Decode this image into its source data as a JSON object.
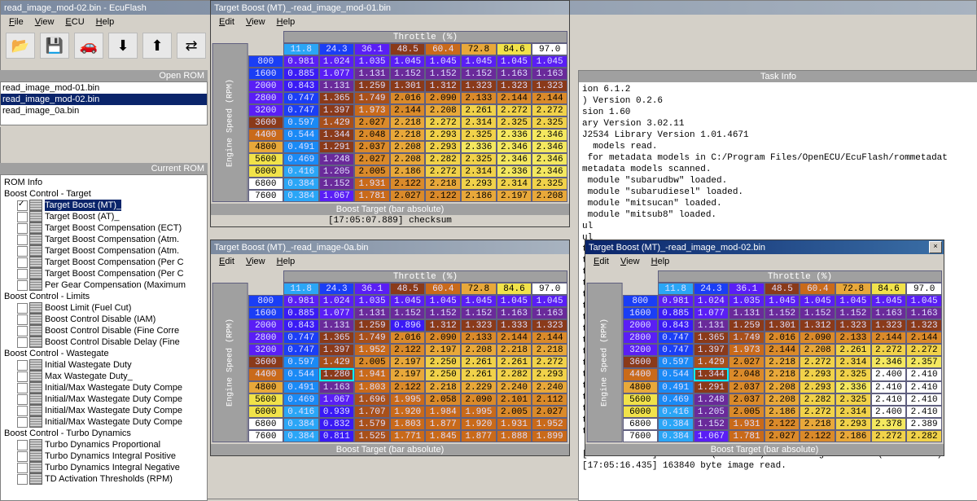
{
  "main": {
    "title": "read_image_mod-02.bin - EcuFlash",
    "menus": [
      "File",
      "View",
      "ECU",
      "Help"
    ],
    "toolbar_icons": [
      "folder-open-icon",
      "save-icon",
      "car-icon",
      "chip-read-icon",
      "chip-write-icon",
      "chip-compare-icon",
      "chip-test-icon"
    ]
  },
  "openrom": {
    "title": "Open ROM",
    "files": [
      "read_image_mod-01.bin",
      "read_image_mod-02.bin",
      "read_image_0a.bin"
    ],
    "selected": 1
  },
  "currentrom": {
    "title": "Current ROM",
    "groups": [
      {
        "label": "ROM Info",
        "depth": 0
      },
      {
        "label": "Boost Control - Target",
        "depth": 0
      },
      {
        "label": "Target Boost (MT)_",
        "depth": 1,
        "checked": true,
        "icon": true,
        "selected": true
      },
      {
        "label": "Target Boost (AT)_",
        "depth": 1,
        "icon": true
      },
      {
        "label": "Target Boost Compensation (ECT)",
        "depth": 1,
        "icon": true
      },
      {
        "label": "Target Boost Compensation (Atm.",
        "depth": 1,
        "icon": true
      },
      {
        "label": "Target Boost Compensation (Atm.",
        "depth": 1,
        "icon": true
      },
      {
        "label": "Target Boost Compensation (Per C",
        "depth": 1,
        "icon": true
      },
      {
        "label": "Target Boost Compensation (Per C",
        "depth": 1,
        "icon": true
      },
      {
        "label": "Per Gear Compensation (Maximum",
        "depth": 1,
        "icon": true
      },
      {
        "label": "Boost Control - Limits",
        "depth": 0
      },
      {
        "label": "Boost Limit (Fuel Cut)",
        "depth": 1,
        "icon": true
      },
      {
        "label": "Boost Control Disable (IAM)",
        "depth": 1,
        "icon": true
      },
      {
        "label": "Boost Control Disable (Fine Corre",
        "depth": 1,
        "icon": true
      },
      {
        "label": "Boost Control Disable Delay (Fine",
        "depth": 1,
        "icon": true
      },
      {
        "label": "Boost Control - Wastegate",
        "depth": 0
      },
      {
        "label": "Initial Wastegate Duty",
        "depth": 1,
        "icon": true
      },
      {
        "label": "Max Wastegate Duty_",
        "depth": 1,
        "icon": true
      },
      {
        "label": "Initial/Max Wastegate Duty Compe",
        "depth": 1,
        "icon": true
      },
      {
        "label": "Initial/Max Wastegate Duty Compe",
        "depth": 1,
        "icon": true
      },
      {
        "label": "Initial/Max Wastegate Duty Compe",
        "depth": 1,
        "icon": true
      },
      {
        "label": "Initial/Max Wastegate Duty Compe",
        "depth": 1,
        "icon": true
      },
      {
        "label": "Boost Control - Turbo Dynamics",
        "depth": 0
      },
      {
        "label": "Turbo Dynamics Proportional",
        "depth": 1,
        "icon": true
      },
      {
        "label": "Turbo Dynamics Integral Positive",
        "depth": 1,
        "icon": true
      },
      {
        "label": "Turbo Dynamics Integral Negative",
        "depth": 1,
        "icon": true
      },
      {
        "label": "TD Activation Thresholds (RPM)",
        "depth": 1,
        "icon": true
      }
    ]
  },
  "throttle_header": "Throttle (%)",
  "engine_speed_label": "Engine Speed (RPM)",
  "footer_label": "Boost Target (bar absolute)",
  "throttle": [
    "11.8",
    "24.3",
    "36.1",
    "48.5",
    "60.4",
    "72.8",
    "84.6",
    "97.0"
  ],
  "rpm": [
    "800",
    "1600",
    "2000",
    "2800",
    "3200",
    "3600",
    "4400",
    "4800",
    "5600",
    "6000",
    "6800",
    "7600"
  ],
  "throttle_colors": [
    "#2aa6f6",
    "#1a3ef5",
    "#5a1ef5",
    "#8a3a1a",
    "#c96a1a",
    "#e8a83a",
    "#f1e24a",
    "#ffffff"
  ],
  "rpm_colors": [
    "#1a3ef5",
    "#1a3ef5",
    "#5a1ef5",
    "#5a1ef5",
    "#5a1ef5",
    "#8a3a1a",
    "#c96a1a",
    "#e8a83a",
    "#f1e24a",
    "#f1e24a",
    "#ffffff",
    "#ffffff"
  ],
  "tables": {
    "mod01": {
      "title": "Target Boost (MT)_-read_image_mod-01.bin",
      "menus": [
        "Edit",
        "View",
        "Help"
      ],
      "log": "[17:05:07.889] checksum",
      "hilight_cell": null,
      "data": [
        [
          "0.981",
          "1.024",
          "1.035",
          "1.045",
          "1.045",
          "1.045",
          "1.045",
          "1.045"
        ],
        [
          "0.885",
          "1.077",
          "1.131",
          "1.152",
          "1.152",
          "1.152",
          "1.163",
          "1.163"
        ],
        [
          "0.843",
          "1.131",
          "1.259",
          "1.301",
          "1.312",
          "1.323",
          "1.323",
          "1.323"
        ],
        [
          "0.747",
          "1.365",
          "1.749",
          "2.016",
          "2.090",
          "2.133",
          "2.144",
          "2.144"
        ],
        [
          "0.747",
          "1.397",
          "1.973",
          "2.144",
          "2.208",
          "2.261",
          "2.272",
          "2.272"
        ],
        [
          "0.597",
          "1.429",
          "2.027",
          "2.218",
          "2.272",
          "2.314",
          "2.325",
          "2.325"
        ],
        [
          "0.544",
          "1.344",
          "2.048",
          "2.218",
          "2.293",
          "2.325",
          "2.336",
          "2.346"
        ],
        [
          "0.491",
          "1.291",
          "2.037",
          "2.208",
          "2.293",
          "2.336",
          "2.346",
          "2.346"
        ],
        [
          "0.469",
          "1.248",
          "2.027",
          "2.208",
          "2.282",
          "2.325",
          "2.346",
          "2.346"
        ],
        [
          "0.416",
          "1.205",
          "2.005",
          "2.186",
          "2.272",
          "2.314",
          "2.336",
          "2.346"
        ],
        [
          "0.384",
          "1.152",
          "1.931",
          "2.122",
          "2.218",
          "2.293",
          "2.314",
          "2.325"
        ],
        [
          "0.384",
          "1.067",
          "1.781",
          "2.027",
          "2.122",
          "2.186",
          "2.197",
          "2.208"
        ]
      ]
    },
    "img0a": {
      "title": "Target Boost (MT)_-read_image-0a.bin",
      "menus": [
        "Edit",
        "View",
        "Help"
      ],
      "hilight_cell": [
        6,
        1
      ],
      "data": [
        [
          "0.981",
          "1.024",
          "1.035",
          "1.045",
          "1.045",
          "1.045",
          "1.045",
          "1.045"
        ],
        [
          "0.885",
          "1.077",
          "1.131",
          "1.152",
          "1.152",
          "1.152",
          "1.163",
          "1.163"
        ],
        [
          "0.843",
          "1.131",
          "1.259",
          "0.896",
          "1.312",
          "1.323",
          "1.333",
          "1.323"
        ],
        [
          "0.747",
          "1.365",
          "1.749",
          "2.016",
          "2.090",
          "2.133",
          "2.144",
          "2.144"
        ],
        [
          "0.747",
          "1.397",
          "1.952",
          "2.122",
          "2.197",
          "2.208",
          "2.218",
          "2.218"
        ],
        [
          "0.597",
          "1.429",
          "2.005",
          "2.197",
          "2.250",
          "2.261",
          "2.261",
          "2.272"
        ],
        [
          "0.544",
          "1.280",
          "1.941",
          "2.197",
          "2.250",
          "2.261",
          "2.282",
          "2.293"
        ],
        [
          "0.491",
          "1.163",
          "1.803",
          "2.122",
          "2.218",
          "2.229",
          "2.240",
          "2.240"
        ],
        [
          "0.469",
          "1.067",
          "1.696",
          "1.995",
          "2.058",
          "2.090",
          "2.101",
          "2.112"
        ],
        [
          "0.416",
          "0.939",
          "1.707",
          "1.920",
          "1.984",
          "1.995",
          "2.005",
          "2.027"
        ],
        [
          "0.384",
          "0.832",
          "1.579",
          "1.803",
          "1.877",
          "1.920",
          "1.931",
          "1.952"
        ],
        [
          "0.384",
          "0.811",
          "1.525",
          "1.771",
          "1.845",
          "1.877",
          "1.888",
          "1.899"
        ]
      ]
    },
    "mod02": {
      "title": "Target Boost (MT)_-read_image_mod-02.bin",
      "active": true,
      "menus": [
        "Edit",
        "View",
        "Help"
      ],
      "hilight_cell": [
        6,
        1
      ],
      "data": [
        [
          "0.981",
          "1.024",
          "1.035",
          "1.045",
          "1.045",
          "1.045",
          "1.045",
          "1.045"
        ],
        [
          "0.885",
          "1.077",
          "1.131",
          "1.152",
          "1.152",
          "1.152",
          "1.163",
          "1.163"
        ],
        [
          "0.843",
          "1.131",
          "1.259",
          "1.301",
          "1.312",
          "1.323",
          "1.323",
          "1.323"
        ],
        [
          "0.747",
          "1.365",
          "1.749",
          "2.016",
          "2.090",
          "2.133",
          "2.144",
          "2.144"
        ],
        [
          "0.747",
          "1.397",
          "1.973",
          "2.144",
          "2.208",
          "2.261",
          "2.272",
          "2.272"
        ],
        [
          "0.597",
          "1.429",
          "2.027",
          "2.218",
          "2.272",
          "2.314",
          "2.346",
          "2.357"
        ],
        [
          "0.544",
          "1.344",
          "2.048",
          "2.218",
          "2.293",
          "2.325",
          "2.400",
          "2.410"
        ],
        [
          "0.491",
          "1.291",
          "2.037",
          "2.208",
          "2.293",
          "2.336",
          "2.410",
          "2.410"
        ],
        [
          "0.469",
          "1.248",
          "2.037",
          "2.208",
          "2.282",
          "2.325",
          "2.410",
          "2.410"
        ],
        [
          "0.416",
          "1.205",
          "2.005",
          "2.186",
          "2.272",
          "2.314",
          "2.400",
          "2.410"
        ],
        [
          "0.384",
          "1.152",
          "1.931",
          "2.122",
          "2.218",
          "2.293",
          "2.378",
          "2.389"
        ],
        [
          "0.384",
          "1.067",
          "1.781",
          "2.027",
          "2.122",
          "2.186",
          "2.272",
          "2.282"
        ]
      ]
    }
  },
  "taskinfo": {
    "title": "Task Info",
    "lines": [
      "ion 6.1.2",
      ") Version 0.2.6",
      "sion 1.60",
      "ary Version 3.02.11",
      "J2534 Library Version 1.01.4671",
      "  models read.",
      " for metadata models in C:/Program Files/OpenECU/EcuFlash/rommetadat",
      "metadata models scanned.",
      " module \"subarudbw\" loaded.",
      " module \"subarudiesel\" loaded.",
      " module \"mitsucan\" loaded.",
      " module \"mitsub8\" loaded.",
      "ul",
      "ul",
      "tc",
      "tc",
      "tc",
      "tc",
      "tc",
      "tc",
      "tc",
      "tc                                                           CU/Ec",
      "tc",
      "tc",
      "tc",
      "tc",
      "tc",
      "tc",
      "tc",
      "tc",
      "tc",
      "",
      "[17:05:16.404] A4TJ111B (0 tables) inheriting A4TJ121C (561 tables)",
      "[17:05:16.435] 163840 byte image read."
    ]
  }
}
